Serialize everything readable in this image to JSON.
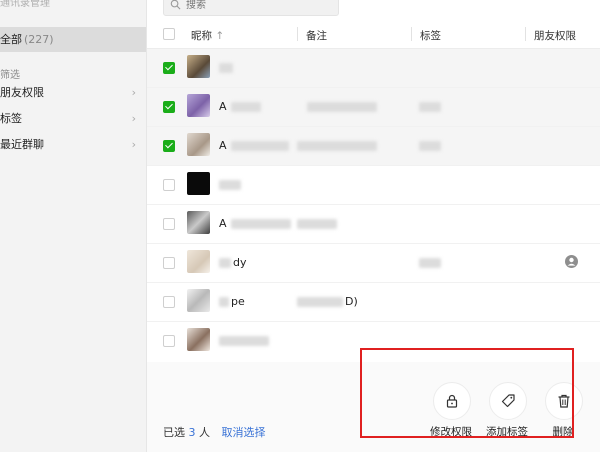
{
  "sidebar": {
    "title": "通讯录管理",
    "all_label": "全部",
    "all_count": "(227)",
    "filter_section": "筛选",
    "items": [
      {
        "label": "朋友权限"
      },
      {
        "label": "标签"
      },
      {
        "label": "最近群聊"
      }
    ]
  },
  "search": {
    "placeholder": "搜索"
  },
  "table": {
    "columns": [
      "昵称",
      "备注",
      "标签",
      "朋友权限"
    ],
    "sort_indicator": "↑",
    "rows": [
      {
        "name": "",
        "checked": true
      },
      {
        "name": "A",
        "checked": true
      },
      {
        "name": "A",
        "checked": true
      },
      {
        "name": "",
        "checked": false
      },
      {
        "name": "A",
        "checked": false
      },
      {
        "name": "dy",
        "checked": false
      },
      {
        "name": "pe",
        "checked": false,
        "remark": "D)"
      },
      {
        "name": "",
        "checked": false
      }
    ]
  },
  "footer": {
    "selected_prefix": "已选",
    "selected_count": "3",
    "selected_suffix": "人",
    "cancel_label": "取消选择",
    "actions": [
      {
        "label": "修改权限",
        "icon": "lock-icon"
      },
      {
        "label": "添加标签",
        "icon": "tag-icon"
      },
      {
        "label": "删除",
        "icon": "trash-icon"
      }
    ]
  },
  "colors": {
    "check_green": "#1aad19",
    "link_blue": "#3a73d6",
    "highlight_red": "#e02020"
  }
}
